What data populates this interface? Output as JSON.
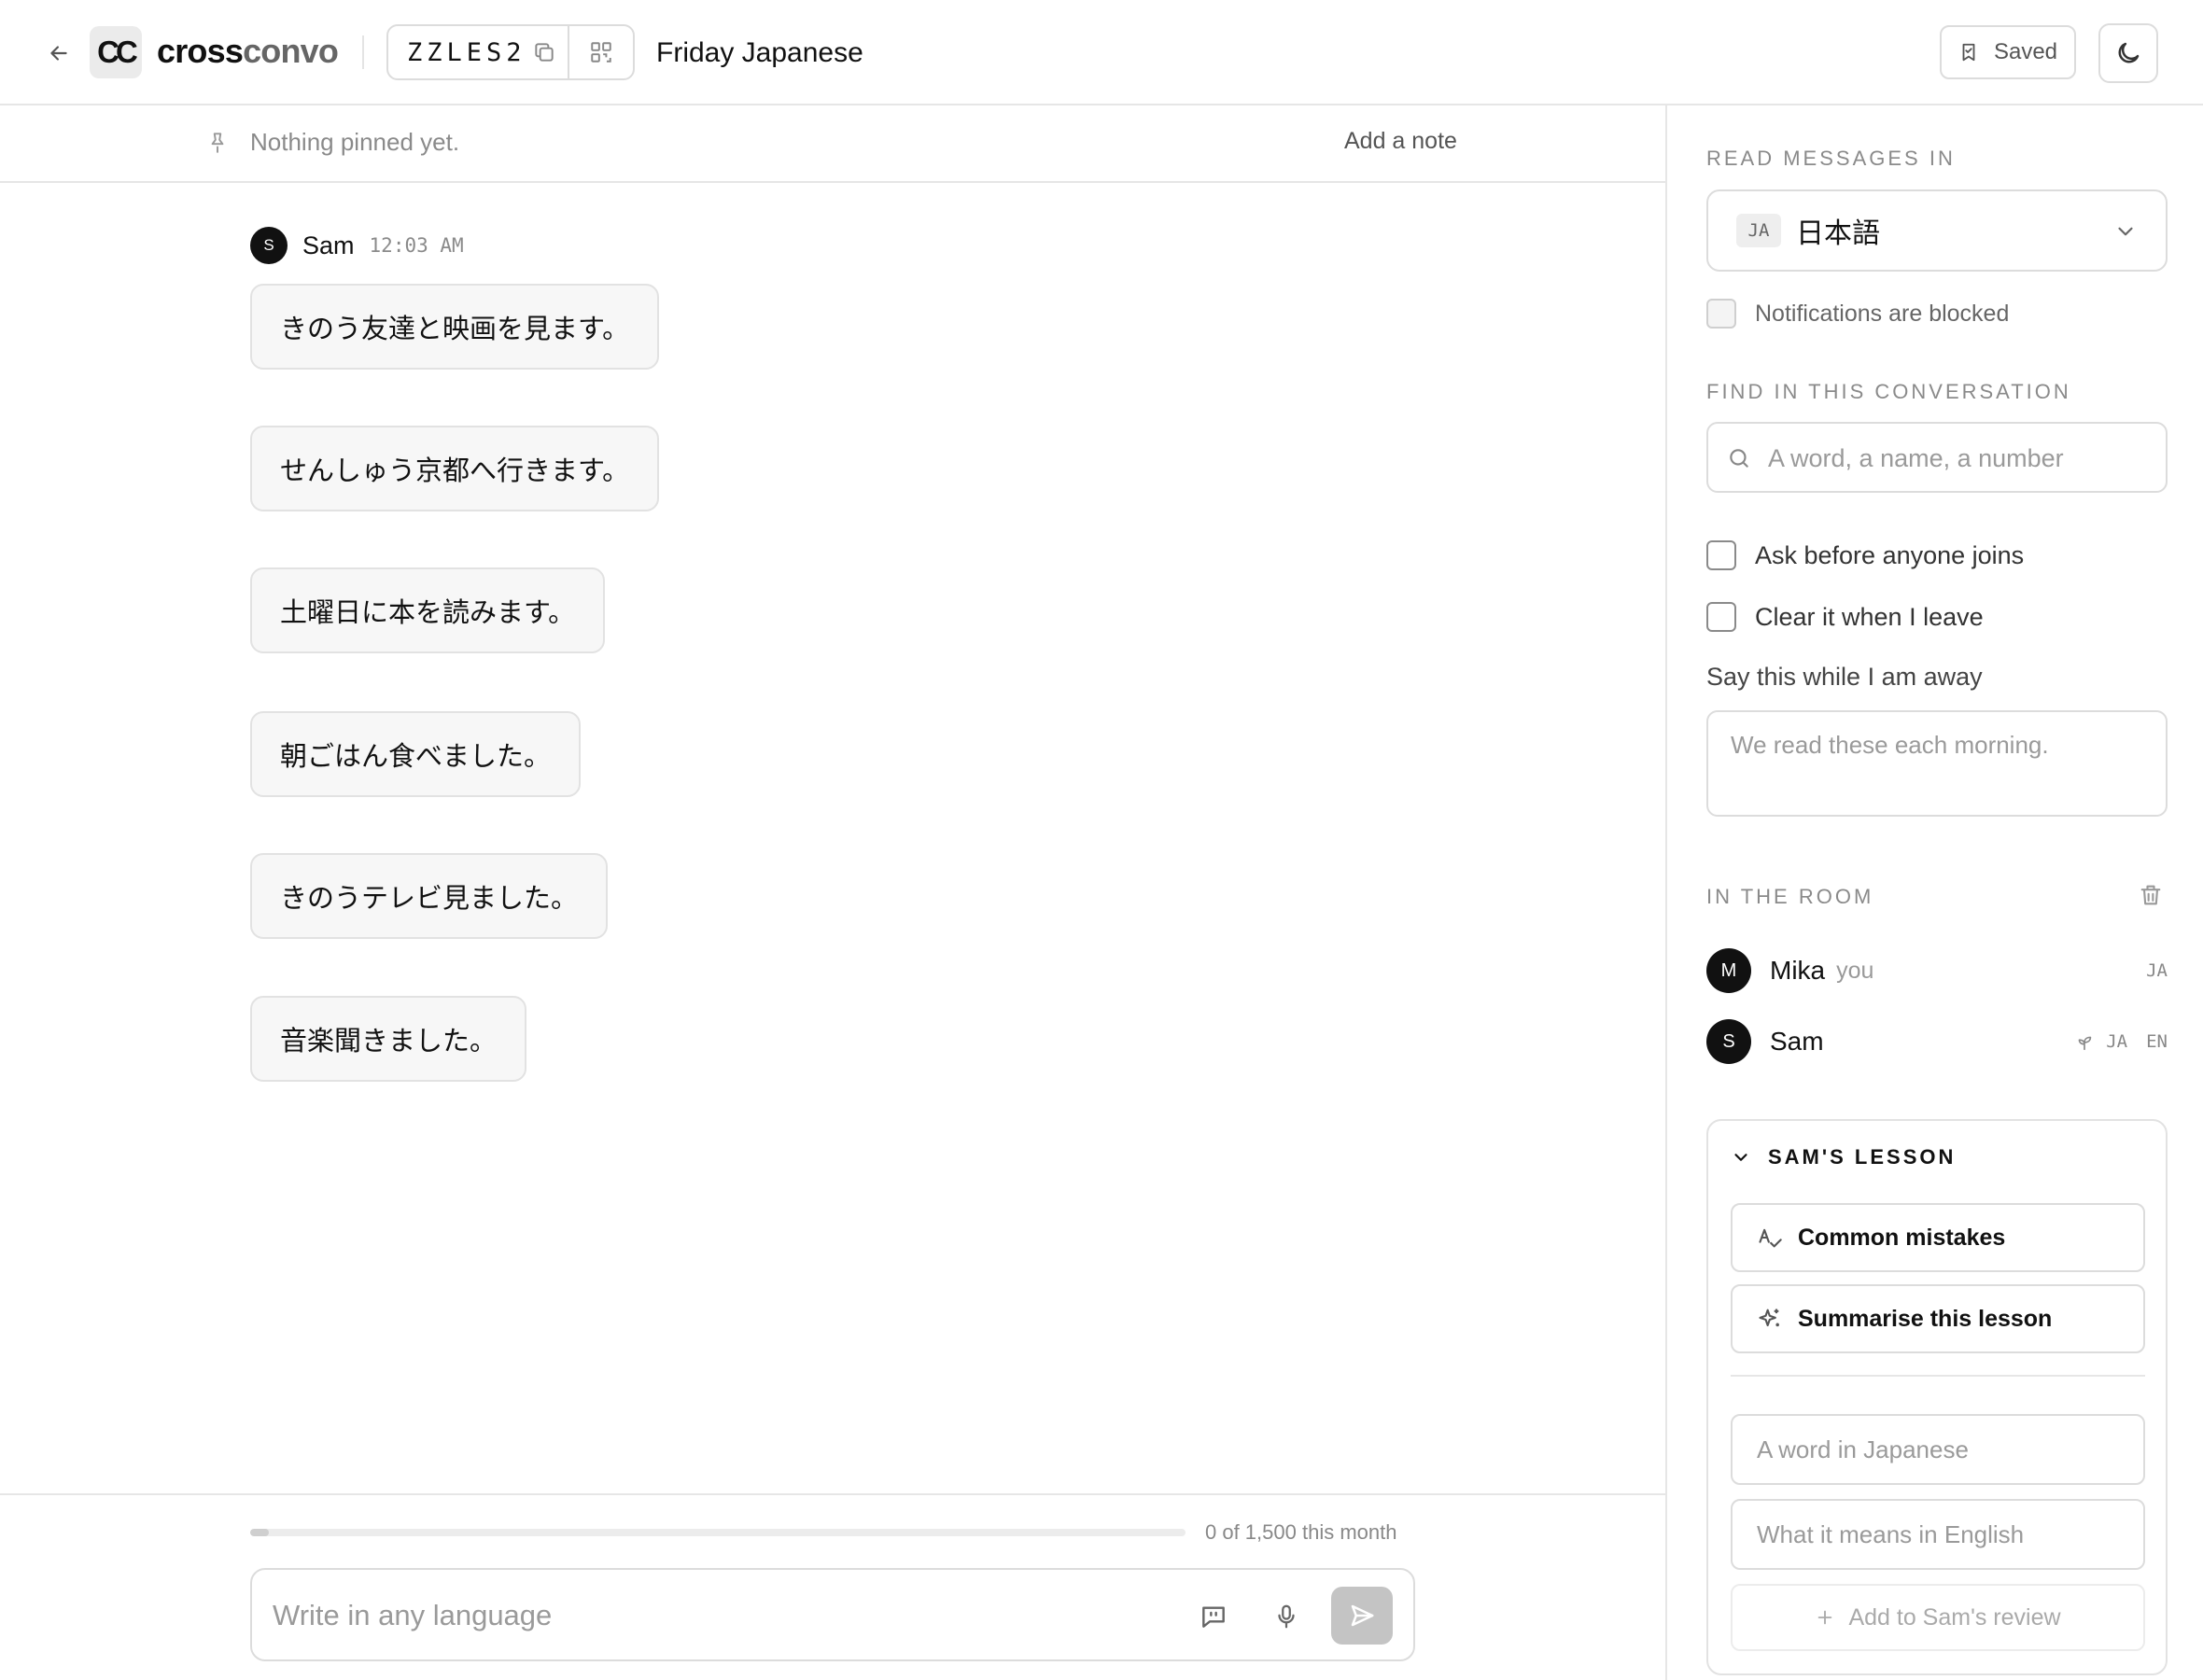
{
  "header": {
    "logo_mark": "CC",
    "brand_part1": "cross",
    "brand_part2": "convo",
    "room_code": "ZZLES2",
    "room_title": "Friday Japanese",
    "saved_label": "Saved"
  },
  "pinbar": {
    "empty_text": "Nothing pinned yet.",
    "add_note_label": "Add a note"
  },
  "messages": {
    "sender_initial": "S",
    "sender_name": "Sam",
    "time": "12:03 AM",
    "bubbles": [
      "きのう友達と映画を見ます。",
      "せんしゅう京都へ行きます。",
      "土曜日に本を読みます。",
      "朝ごはん食べました。",
      "きのうテレビ見ました。",
      "音楽聞きました。"
    ]
  },
  "composer": {
    "usage_text": "0 of 1,500 this month",
    "usage_used": 0,
    "usage_limit": 1500,
    "placeholder": "Write in any language"
  },
  "sidebar": {
    "read_label": "READ MESSAGES IN",
    "lang_code": "JA",
    "lang_name": "日本語",
    "notifications_label": "Notifications are blocked",
    "find_label": "FIND IN THIS CONVERSATION",
    "search_placeholder": "A word, a name, a number",
    "ask_label": "Ask before anyone joins",
    "clear_label": "Clear it when I leave",
    "away_label": "Say this while I am away",
    "away_placeholder": "We read these each morning.",
    "room_label": "IN THE ROOM",
    "members": [
      {
        "initial": "M",
        "name": "Mika",
        "tag": "you",
        "langs": [
          "JA"
        ]
      },
      {
        "initial": "S",
        "name": "Sam",
        "tag": "",
        "langs": [
          "JA",
          "EN"
        ]
      }
    ],
    "lesson": {
      "title": "SAM'S LESSON",
      "mistakes_label": "Common mistakes",
      "summary_label": "Summarise this lesson",
      "word_placeholder": "A word in Japanese",
      "meaning_placeholder": "What it means in English",
      "add_label": "Add to Sam's review"
    }
  }
}
